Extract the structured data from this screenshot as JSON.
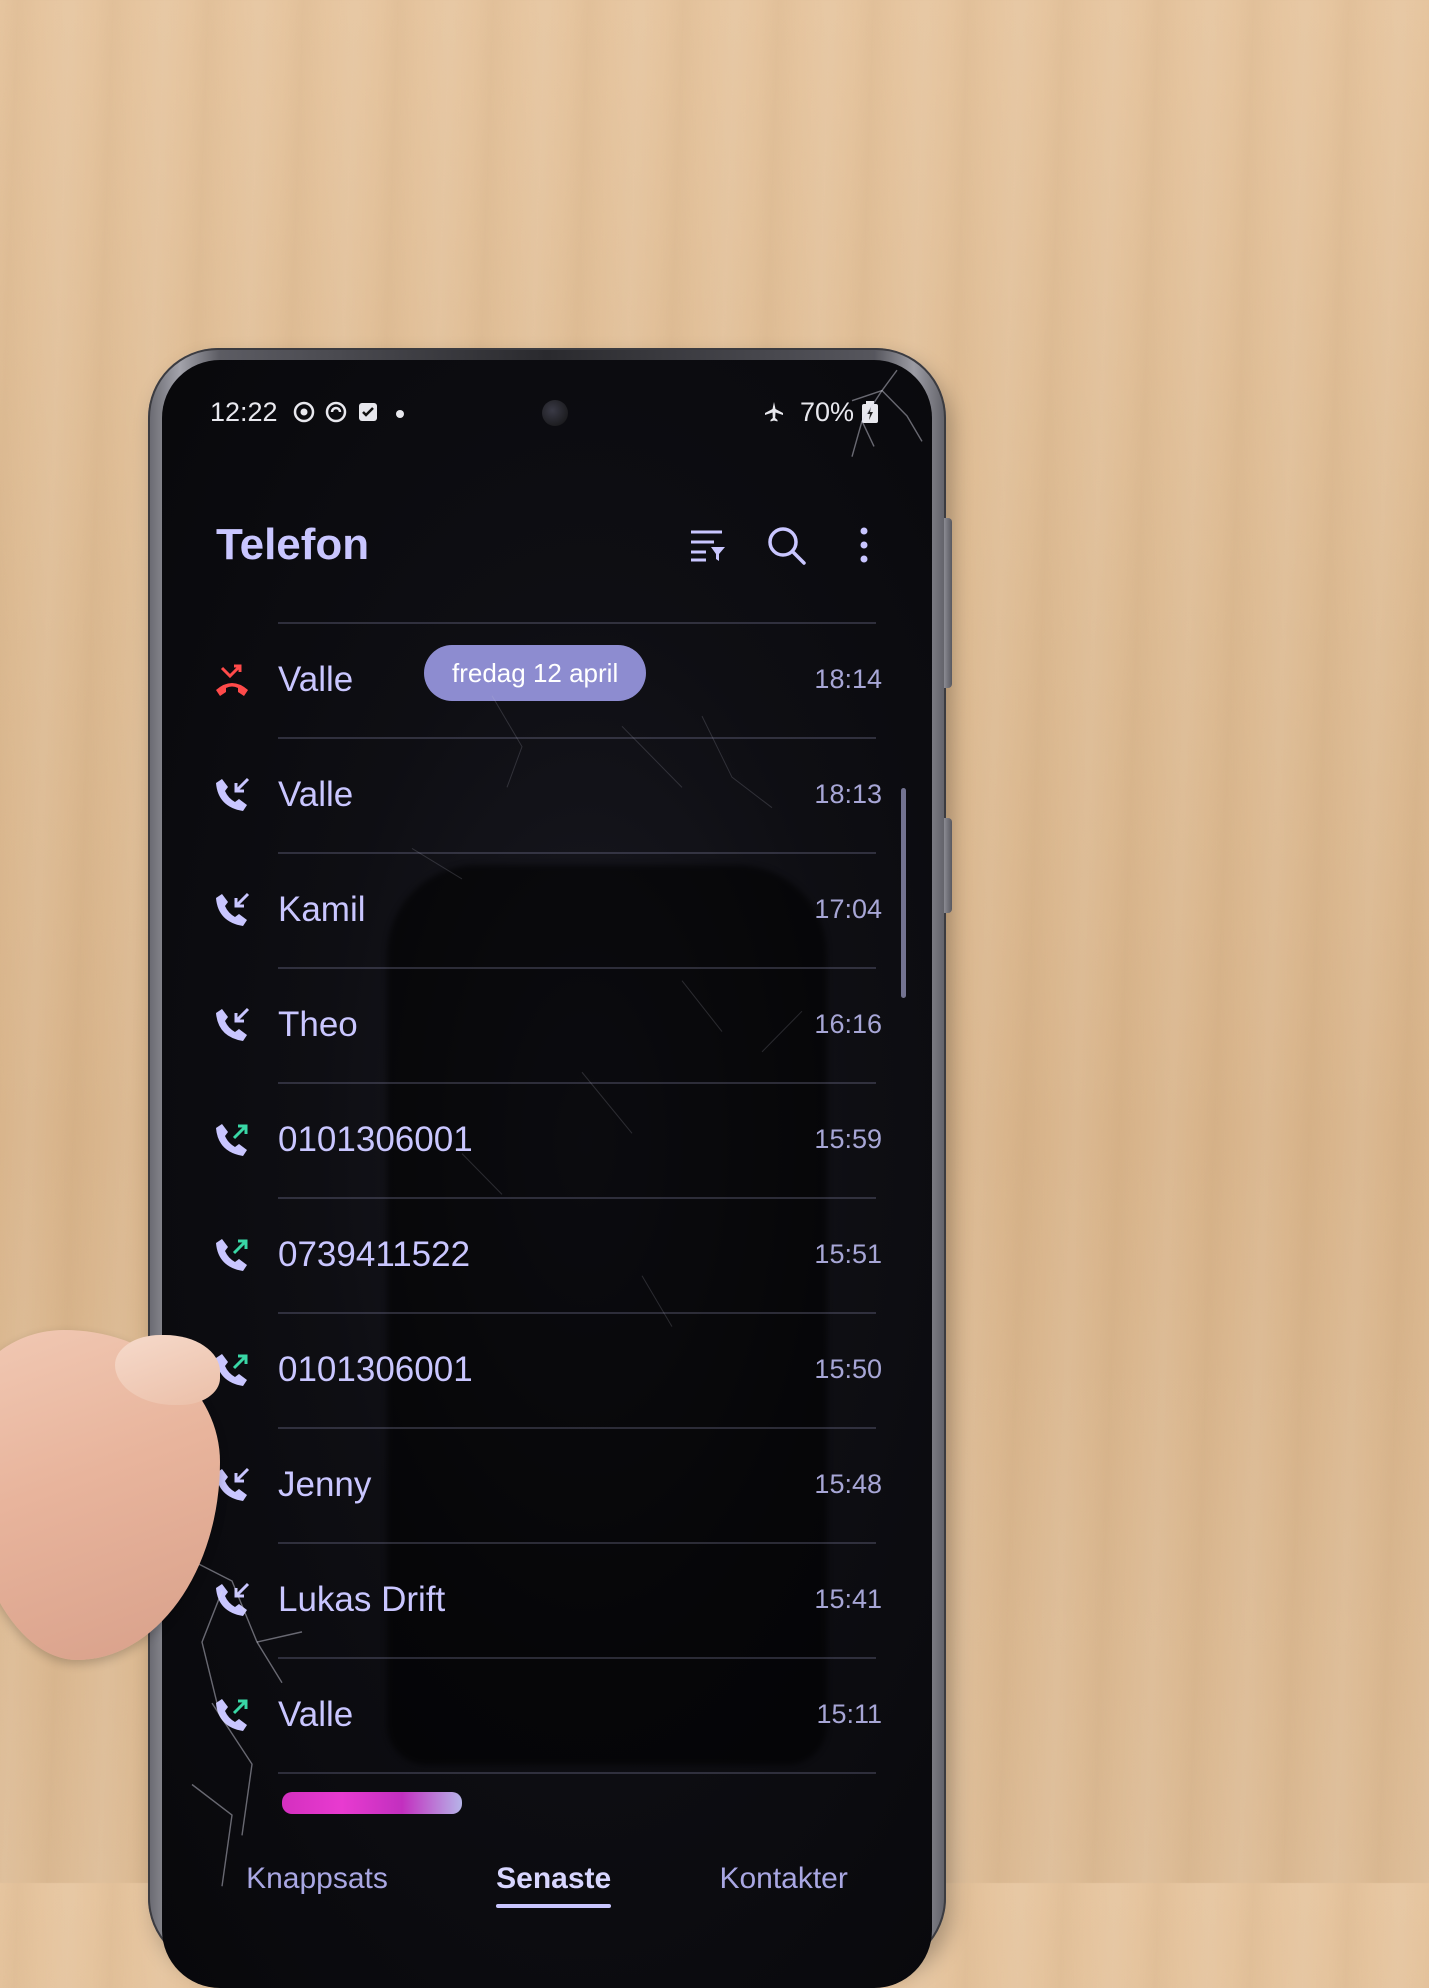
{
  "status_bar": {
    "time": "12:22",
    "icons": [
      "sync-icon",
      "vpn-icon",
      "calendar-check-icon",
      "dot-icon"
    ],
    "airplane_mode_icon": "airplane-icon",
    "battery": "70%"
  },
  "app": {
    "title": "Telefon",
    "actions": [
      "filter-icon",
      "search-icon",
      "more-vert-icon"
    ]
  },
  "date_separator": "fredag 12 april",
  "calls": [
    {
      "name": "Valle",
      "time": "18:14",
      "type": "missed"
    },
    {
      "name": "Valle",
      "time": "18:13",
      "type": "incoming"
    },
    {
      "name": "Kamil",
      "time": "17:04",
      "type": "incoming"
    },
    {
      "name": "Theo",
      "time": "16:16",
      "type": "incoming"
    },
    {
      "name": "0101306001",
      "time": "15:59",
      "type": "outgoing"
    },
    {
      "name": "0739411522",
      "time": "15:51",
      "type": "outgoing"
    },
    {
      "name": "0101306001",
      "time": "15:50",
      "type": "outgoing"
    },
    {
      "name": "Jenny",
      "time": "15:48",
      "type": "incoming"
    },
    {
      "name": "Lukas Drift",
      "time": "15:41",
      "type": "incoming"
    },
    {
      "name": "Valle",
      "time": "15:11",
      "type": "outgoing"
    }
  ],
  "tabs": [
    {
      "label": "Knappsats",
      "active": false
    },
    {
      "label": "Senaste",
      "active": true
    },
    {
      "label": "Kontakter",
      "active": false
    }
  ],
  "colors": {
    "accent": "#c9c6ff",
    "missed": "#ff4a4a",
    "outgoing_arrow": "#39d7a6",
    "incoming_arrow": "#c9c6ff",
    "date_pill": "#8d8cd0"
  }
}
